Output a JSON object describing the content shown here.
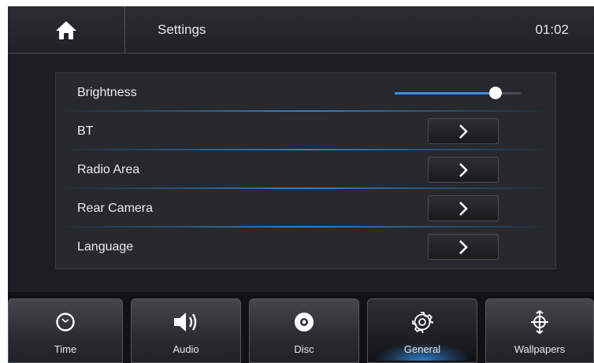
{
  "header": {
    "home_icon": "home-icon",
    "title": "Settings",
    "time": "01:02"
  },
  "settings": {
    "brightness": {
      "label": "Brightness",
      "level": 0.8
    },
    "items": [
      {
        "label": "BT",
        "icon": "chevron-right-icon"
      },
      {
        "label": "Radio Area",
        "icon": "chevron-right-icon"
      },
      {
        "label": "Rear Camera",
        "icon": "chevron-right-icon"
      },
      {
        "label": "Language",
        "icon": "chevron-right-icon"
      }
    ]
  },
  "tabs": [
    {
      "label": "Time",
      "icon": "clock-icon",
      "active": false
    },
    {
      "label": "Audio",
      "icon": "speaker-icon",
      "active": false
    },
    {
      "label": "Disc",
      "icon": "disc-icon",
      "active": false
    },
    {
      "label": "General",
      "icon": "gear-icon",
      "active": true
    },
    {
      "label": "Wallpapers",
      "icon": "wallpaper-icon",
      "active": false
    }
  ],
  "colors": {
    "accent": "#3d8be0",
    "background": "#1c1e21"
  }
}
